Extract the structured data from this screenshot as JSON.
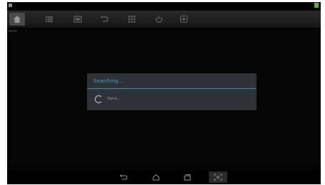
{
  "toolbar": {
    "home_label": "Home",
    "items": [
      "home-icon",
      "list-icon",
      "window-icon",
      "back-arrow-icon",
      "grid-icon",
      "power-icon",
      "settings-icon"
    ],
    "small_label": ""
  },
  "dialog": {
    "title": "Searching...",
    "message": "Nano..."
  },
  "navbar": {
    "items": [
      "back-icon",
      "home-icon",
      "recent-apps-icon",
      "screenshot-icon"
    ]
  },
  "colors": {
    "accent": "#38a0c8",
    "status_battery": "#5fb32f"
  }
}
